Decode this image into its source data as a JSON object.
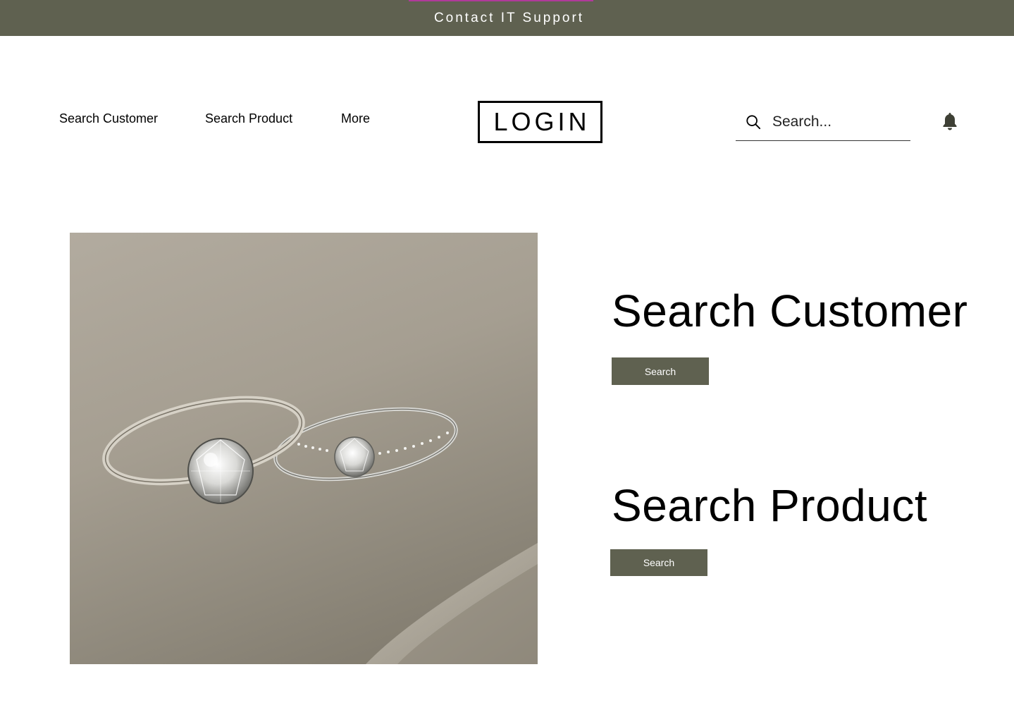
{
  "banner": {
    "link_label": "Contact IT Support",
    "background_color": "#5f6150",
    "accent_color": "#b03a9a"
  },
  "header": {
    "nav": [
      {
        "label": "Search Customer"
      },
      {
        "label": "Search Product"
      },
      {
        "label": "More"
      }
    ],
    "login_label": "LOGIN",
    "search": {
      "placeholder": "Search...",
      "icon": "search-icon"
    },
    "notification_icon": "bell-icon"
  },
  "hero": {
    "image_subject": "two diamond solitaire rings on a grey surface"
  },
  "sections": {
    "customer": {
      "heading": "Search Customer",
      "button_label": "Search"
    },
    "product": {
      "heading": "Search Product",
      "button_label": "Search"
    }
  },
  "colors": {
    "button_bg": "#5f6150",
    "button_text": "#ffffff"
  }
}
